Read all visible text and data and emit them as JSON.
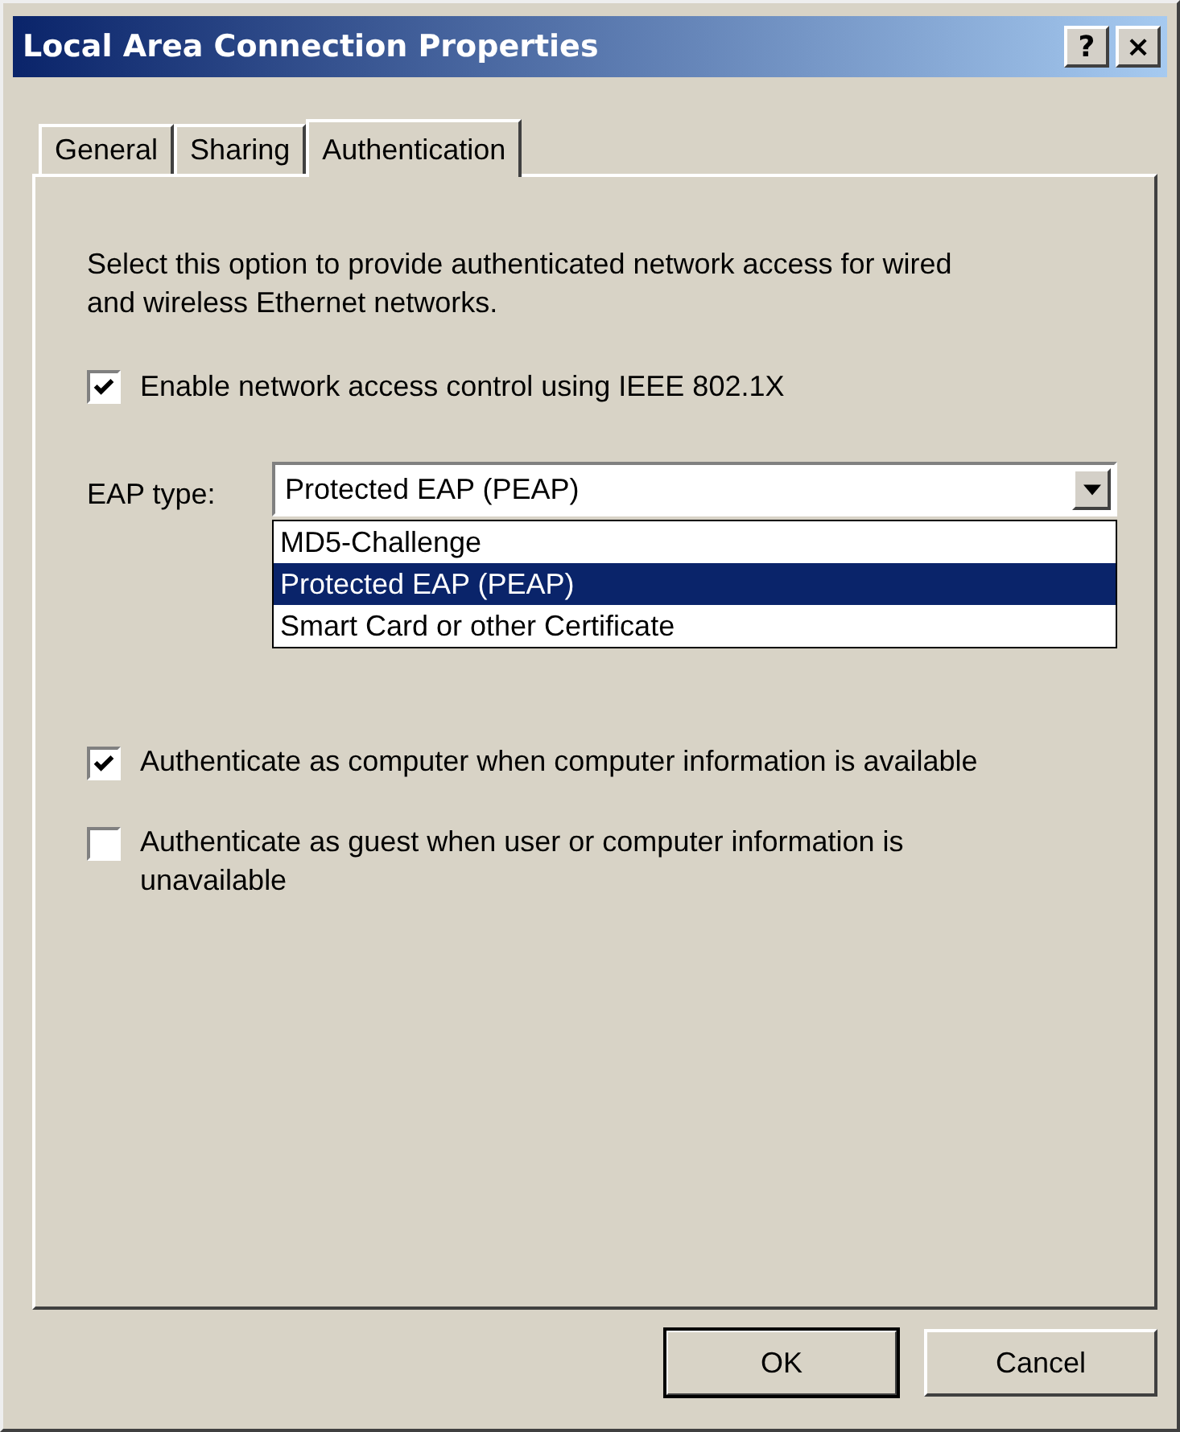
{
  "window": {
    "title": "Local Area Connection Properties",
    "title_buttons": [
      "?",
      "×"
    ]
  },
  "tabs": [
    {
      "label": "General",
      "selected": false
    },
    {
      "label": "Sharing",
      "selected": false
    },
    {
      "label": "Authentication",
      "selected": true
    }
  ],
  "description": "Select this option to provide authenticated network access for wired and wireless Ethernet networks.",
  "enable_checkbox": {
    "label": "Enable network access control using IEEE 802.1X",
    "checked": true
  },
  "eap_type": {
    "label": "EAP type:",
    "value": "Protected EAP (PEAP)",
    "expanded": true,
    "options": [
      {
        "label": "MD5-Challenge",
        "selected": false
      },
      {
        "label": "Protected EAP (PEAP)",
        "selected": true
      },
      {
        "label": "Smart Card or other Certificate",
        "selected": false
      }
    ]
  },
  "checkboxes": [
    {
      "label": "Authenticate as computer when computer information is available",
      "checked": true
    },
    {
      "label": "Authenticate as guest when user or computer information is unavailable",
      "checked": false
    }
  ],
  "buttons": [
    {
      "label": "OK",
      "default": true
    },
    {
      "label": "Cancel",
      "default": false
    }
  ]
}
